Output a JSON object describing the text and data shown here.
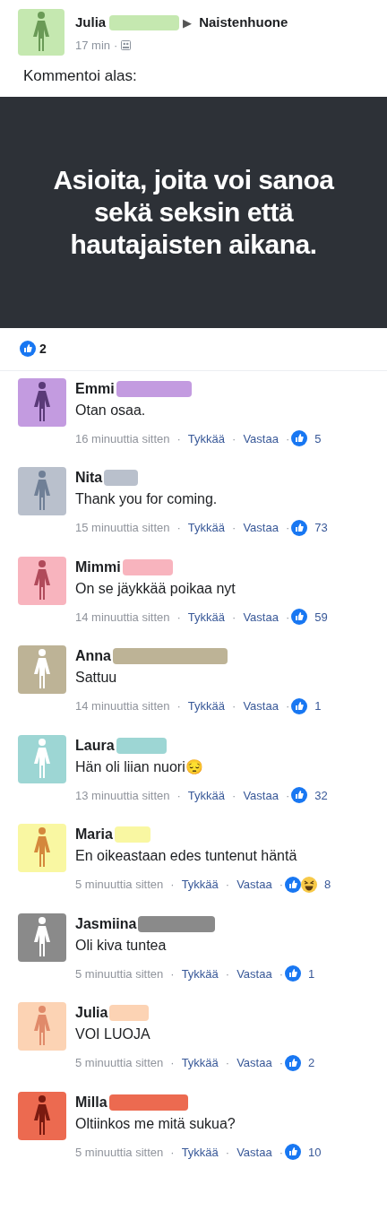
{
  "post": {
    "author": "Julia",
    "avatar": {
      "color": "#c5e8b0",
      "figure": {
        "color": "#6a9a56"
      }
    },
    "arrow": "▶",
    "group": "Naistenhuone",
    "time": "17 min",
    "separator": "·",
    "text": "Kommentoi alas:",
    "banner": "Asioita, joita voi sanoa sekä seksin että hautajaisten aikana.",
    "likes": "2"
  },
  "comments": [
    {
      "name": "Emmi",
      "avatar": {
        "color": "#c39be0",
        "figure": {
          "color": "#5a3a78"
        }
      },
      "text": "Otan osaa.",
      "time": "16 minuuttia sitten",
      "separator": "·",
      "like": "Tykkää",
      "reply": "Vastaa",
      "reactions": [
        {
          "kind": "like"
        }
      ],
      "count": "5"
    },
    {
      "name": "Nita",
      "avatar": {
        "color": "#b9c0cc",
        "figure": {
          "color": "#6f7f96"
        }
      },
      "text": "Thank you for coming.",
      "time": "15 minuuttia sitten",
      "separator": "·",
      "like": "Tykkää",
      "reply": "Vastaa",
      "reactions": [
        {
          "kind": "like"
        }
      ],
      "count": "73"
    },
    {
      "name": "Mimmi",
      "avatar": {
        "color": "#f8b4be",
        "figure": {
          "color": "#b04a5a"
        }
      },
      "text": "On se jäykkää poikaa nyt",
      "time": "14 minuuttia sitten",
      "separator": "·",
      "like": "Tykkää",
      "reply": "Vastaa",
      "reactions": [
        {
          "kind": "like"
        }
      ],
      "count": "59"
    },
    {
      "name": "Anna",
      "avatar": {
        "color": "#bdb396",
        "figure": {
          "color": "#ffffff"
        }
      },
      "text": "Sattuu",
      "time": "14 minuuttia sitten",
      "separator": "·",
      "like": "Tykkää",
      "reply": "Vastaa",
      "reactions": [
        {
          "kind": "like"
        }
      ],
      "count": "1"
    },
    {
      "name": "Laura",
      "avatar": {
        "color": "#9dd6d4",
        "figure": {
          "color": "#ffffff"
        }
      },
      "text": "Hän oli liian nuori😔",
      "time": "13 minuuttia sitten",
      "separator": "·",
      "like": "Tykkää",
      "reply": "Vastaa",
      "reactions": [
        {
          "kind": "like"
        }
      ],
      "count": "32"
    },
    {
      "name": "Maria",
      "avatar": {
        "color": "#f9f7a2",
        "figure": {
          "color": "#d4883c"
        }
      },
      "text": "En oikeastaan edes tuntenut häntä",
      "time": "5 minuuttia sitten",
      "separator": "·",
      "like": "Tykkää",
      "reply": "Vastaa",
      "reactions": [
        {
          "kind": "like"
        },
        {
          "kind": "haha"
        }
      ],
      "count": "8"
    },
    {
      "name": "Jasmiina",
      "avatar": {
        "color": "#8a8a8a",
        "figure": {
          "color": "#ffffff"
        }
      },
      "text": "Oli kiva tuntea",
      "time": "5 minuuttia sitten",
      "separator": "·",
      "like": "Tykkää",
      "reply": "Vastaa",
      "reactions": [
        {
          "kind": "like"
        }
      ],
      "count": "1"
    },
    {
      "name": "Julia",
      "avatar": {
        "color": "#fcd3b4",
        "figure": {
          "color": "#e08a6a"
        }
      },
      "text": "VOI LUOJA",
      "time": "5 minuuttia sitten",
      "separator": "·",
      "like": "Tykkää",
      "reply": "Vastaa",
      "reactions": [
        {
          "kind": "like"
        }
      ],
      "count": "2"
    },
    {
      "name": "Milla",
      "avatar": {
        "color": "#ec6a50",
        "figure": {
          "color": "#7a1a10"
        }
      },
      "text": "Oltiinkos me mitä sukua?",
      "time": "5 minuuttia sitten",
      "separator": "·",
      "like": "Tykkää",
      "reply": "Vastaa",
      "reactions": [
        {
          "kind": "like"
        }
      ],
      "count": "10"
    }
  ]
}
